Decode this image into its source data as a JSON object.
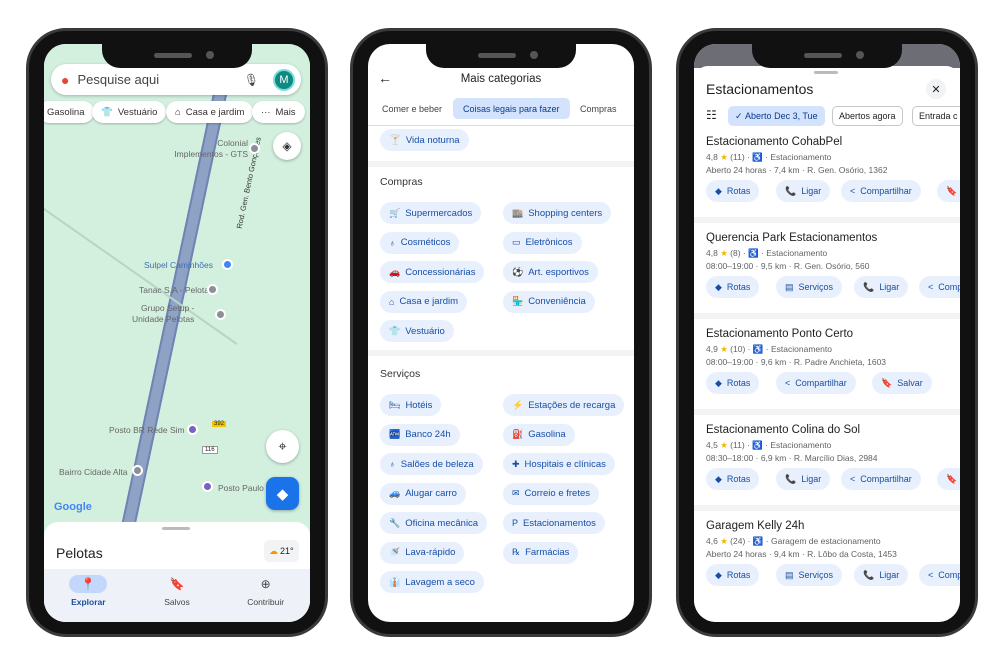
{
  "left": {
    "search_placeholder": "Pesquise aqui",
    "avatar_letter": "M",
    "chips": [
      "Gasolina",
      "Vestuário",
      "Casa e jardim",
      "Mais"
    ],
    "pois": {
      "colonial": "Colonial\nImplementos - GTS",
      "sulpel": "Sulpel Caminhões",
      "tanac": "Tanac S.A - Pelotas",
      "setup": "Grupo Setup -\nUnidade Pelotas",
      "posto_br": "Posto BR Rede Sim",
      "bairro": "Bairro Cidade Alta",
      "posto_paulo": "Posto Paulo",
      "road": "Rod. Gen. Bento Gonçalves",
      "shield_116": "116",
      "shield_392": "392"
    },
    "google_logo": "Google",
    "sheet_title": "Pelotas",
    "weather": "21°",
    "nav": [
      "Explorar",
      "Salvos",
      "Contribuir"
    ]
  },
  "middle": {
    "title": "Mais categorias",
    "tabs": [
      "Comer e beber",
      "Coisas legais para fazer",
      "Compras"
    ],
    "active_tab": 1,
    "top_chip": "Vida noturna",
    "sections": [
      {
        "title": "Compras",
        "left": [
          "Supermercados",
          "Cosméticos",
          "Concessionárias",
          "Casa e jardim",
          "Vestuário"
        ],
        "right": [
          "Shopping centers",
          "Eletrônicos",
          "Art. esportivos",
          "Conveniência"
        ]
      },
      {
        "title": "Serviços",
        "left": [
          "Hotéis",
          "Banco 24h",
          "Salões de beleza",
          "Alugar carro",
          "Oficina mecânica",
          "Lava-rápido",
          "Lavagem a seco"
        ],
        "right": [
          "Estações de recarga",
          "Gasolina",
          "Hospitais e clínicas",
          "Correio e fretes",
          "Estacionamentos",
          "Farmácias"
        ]
      }
    ]
  },
  "right": {
    "title": "Estacionamentos",
    "filters": [
      "Aberto Dec 3, Tue",
      "Abertos agora",
      "Entrada c"
    ],
    "results": [
      {
        "name": "Estacionamento CohabPel",
        "rating": "4,8",
        "reviews": "(11)",
        "type": "Estacionamento",
        "details": "Aberto 24 horas · 7,4 km · R. Gen. Osório, 1362",
        "actions": [
          "Rotas",
          "Ligar",
          "Compartilhar",
          "Salvar"
        ]
      },
      {
        "name": "Querencia Park Estacionamentos",
        "rating": "4,8",
        "reviews": "(8)",
        "type": "Estacionamento",
        "details": "08:00–19:00 · 9,5 km · R. Gen. Osório, 560",
        "actions": [
          "Rotas",
          "Serviços",
          "Ligar",
          "Compartilhar"
        ]
      },
      {
        "name": "Estacionamento Ponto Certo",
        "rating": "4,9",
        "reviews": "(10)",
        "type": "Estacionamento",
        "details": "08:00–19:00 · 9,6 km · R. Padre Anchieta, 1603",
        "actions": [
          "Rotas",
          "Compartilhar",
          "Salvar"
        ]
      },
      {
        "name": "Estacionamento Colina do Sol",
        "rating": "4,5",
        "reviews": "(11)",
        "type": "Estacionamento",
        "details": "08:30–18:00 · 6,9 km · R. Marcílio Dias, 2984",
        "actions": [
          "Rotas",
          "Ligar",
          "Compartilhar",
          "Salvar"
        ]
      },
      {
        "name": "Garagem Kelly 24h",
        "rating": "4,6",
        "reviews": "(24)",
        "type": "Garagem de estacionamento",
        "details": "Aberto 24 horas · 9,4 km · R. Lôbo da Costa, 1453",
        "actions": [
          "Rotas",
          "Serviços",
          "Ligar",
          "Compartilhar"
        ]
      }
    ]
  },
  "colors": {
    "accent": "#1a73e8",
    "chip_bg": "#e8f0fe",
    "map": "#d3f0df",
    "star": "#f4b400"
  }
}
